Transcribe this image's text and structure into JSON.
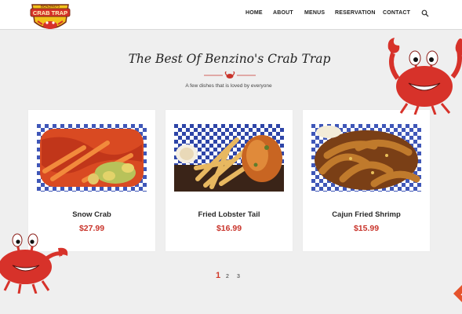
{
  "logo": {
    "top_text": "BENZINO'S",
    "main_text": "CRAB TRAP",
    "icon": "crab-logo-icon"
  },
  "nav": {
    "items": [
      "HOME",
      "ABOUT",
      "MENUS",
      "RESERVATION",
      "CONTACT"
    ],
    "search_icon": "search-icon"
  },
  "section": {
    "title": "The Best Of Benzino's Crab Trap",
    "subtitle": "A few dishes that is loved by everyone"
  },
  "dishes": [
    {
      "name": "Snow Crab",
      "price": "$27.99",
      "image": "snow-crab-image"
    },
    {
      "name": "Fried Lobster Tail",
      "price": "$16.99",
      "image": "fried-lobster-tail-image"
    },
    {
      "name": "Cajun Fried Shrimp",
      "price": "$15.99",
      "image": "cajun-fried-shrimp-image"
    }
  ],
  "pagination": {
    "pages": [
      "1",
      "2",
      "3"
    ],
    "current": "1"
  },
  "colors": {
    "accent": "#c9342b",
    "background": "#efefef",
    "card": "#ffffff",
    "text_dark": "#222222",
    "crab_red": "#d7322a"
  }
}
